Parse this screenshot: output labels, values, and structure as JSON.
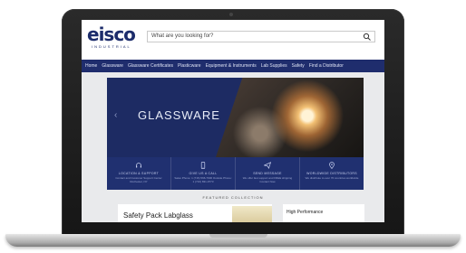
{
  "site": {
    "logo": "eisco",
    "logo_sub": "INDUSTRIAL",
    "search_placeholder": "What are you looking for?"
  },
  "nav": {
    "items": [
      "Home",
      "Glassware",
      "Glassware Certificates",
      "Plasticware",
      "Equipment & Instruments",
      "Lab Supplies",
      "Safety",
      "Find a Distributor"
    ]
  },
  "hero": {
    "title": "GLASSWARE",
    "prev_label": "‹"
  },
  "info": [
    {
      "heading": "LOCATION & SUPPORT",
      "text": "Contact and Customer Support Center Rochester, NY"
    },
    {
      "heading": "GIVE US A CALL",
      "text": "Sales Phone: 1 (716) 566-7900 Outside Phone: 1 (716) 831-9773"
    },
    {
      "heading": "SEND MESSAGE",
      "text": "We offer fast support and FREE shipping Contact Now"
    },
    {
      "heading": "WORLDWIDE DISTRIBUTORS",
      "text": "We distribute to over 70 countries worldwide"
    }
  ],
  "featured": {
    "label": "FEATURED COLLECTION",
    "card1_title": "Safety Pack Labglass",
    "card2_title": "High Performance"
  },
  "colors": {
    "brand_navy": "#1f2d6d",
    "brand_blue": "#2c86d6"
  }
}
